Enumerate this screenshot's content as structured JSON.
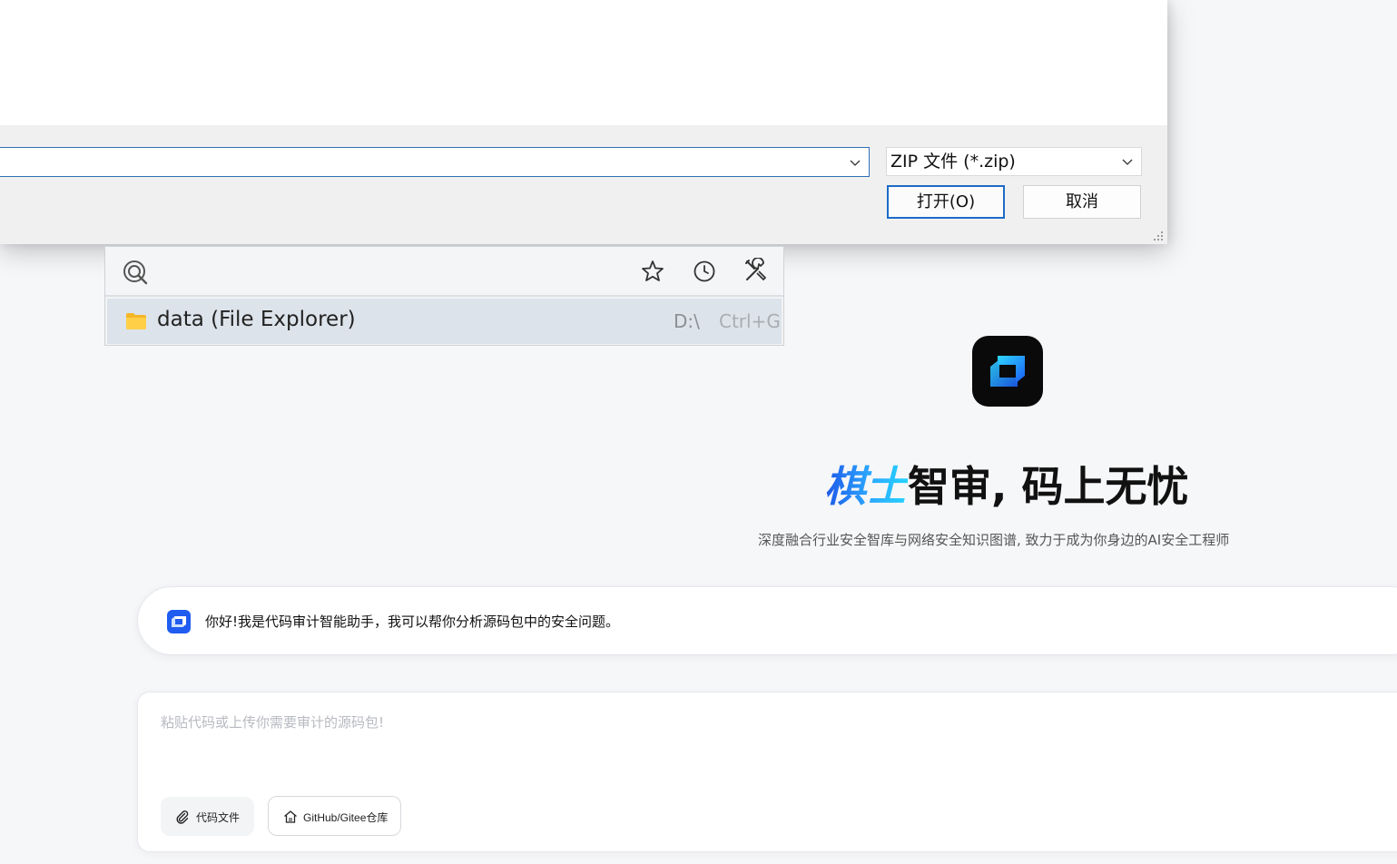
{
  "file_dialog": {
    "filename_value": "",
    "file_type_selected": "ZIP 文件 (*.zip)",
    "open_button": "打开(O)",
    "cancel_button": "取消"
  },
  "launcher": {
    "query": "",
    "icons": [
      "search-icon",
      "star-icon",
      "clock-icon",
      "tools-icon"
    ],
    "result": {
      "name": "data (File Explorer)",
      "path": "D:\\",
      "shortcut": "Ctrl+G",
      "icon": "folder-icon"
    }
  },
  "hero": {
    "brand": "棋士",
    "title_rest": "智审, 码上无忧",
    "subtitle": "深度融合行业安全智库与网络安全知识图谱, 致力于成为你身边的AI安全工程师"
  },
  "greeting": {
    "text": "你好!我是代码审计智能助手，我可以帮你分析源码包中的安全问题。"
  },
  "input": {
    "placeholder": "粘贴代码或上传你需要审计的源码包!",
    "attach_label": "代码文件",
    "repo_label": "GitHub/Gitee仓库"
  },
  "colors": {
    "accent_blue": "#1f5cf0",
    "brand_gradient_start": "#1d56e8",
    "brand_gradient_end": "#27d3ff",
    "dialog_focus_border": "#1c6bc7",
    "page_background": "#f6f7f9"
  }
}
